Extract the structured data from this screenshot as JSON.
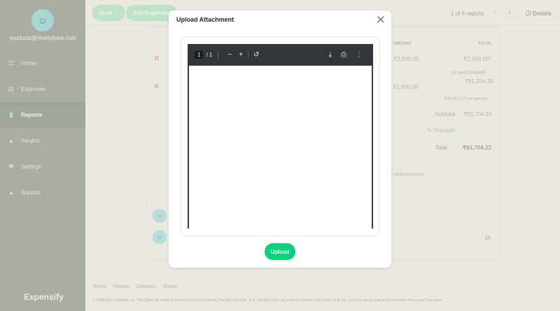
{
  "sidebar": {
    "email": "products@nicelydone.club",
    "items": [
      {
        "label": "Home",
        "icon": "home-icon"
      },
      {
        "label": "Expenses",
        "icon": "receipt-icon"
      },
      {
        "label": "Reports",
        "icon": "document-icon"
      },
      {
        "label": "Insights",
        "icon": "lightbulb-icon"
      },
      {
        "label": "Settings",
        "icon": "gear-icon"
      },
      {
        "label": "Support",
        "icon": "chat-icon"
      }
    ],
    "logo": "Expensify"
  },
  "header": {
    "send": "Send",
    "add_expenses": "Add Expenses",
    "pager": "1 of 6 reports",
    "details": "Details"
  },
  "report": {
    "col_amount": "AMOUNT",
    "col_total": "TOTAL",
    "rows": [
      {
        "amount": "₹2,500.00",
        "total": "₹2,500.00*"
      },
      {
        "amount": "€1,000.00",
        "rate": "91.2043  EUR/INR",
        "total": "₹91,204.33",
        "per_person": "₹45,602.17 per person"
      }
    ],
    "subtotal_label": "Subtotal",
    "subtotal": "₹93,704.33",
    "discount": "Discount",
    "total_label": "Total",
    "total": "₹93,704.33",
    "note": "s original expense"
  },
  "modal": {
    "title": "Upload Attachment",
    "page_current": "1",
    "page_total": "/ 1",
    "upload": "Upload"
  },
  "footer": {
    "links": [
      "Terms",
      "Privacy",
      "Licenses",
      "Status"
    ],
    "copyright": "© 2008-2024 Expensify, Inc. The Expensify Visa® Commercial Card is issued by The Bancorp Bank, N.A., Member FDIC, pursuant to a license from Visa U.S.A. Inc. and may not be used at all merchants that accept Visa cards."
  }
}
